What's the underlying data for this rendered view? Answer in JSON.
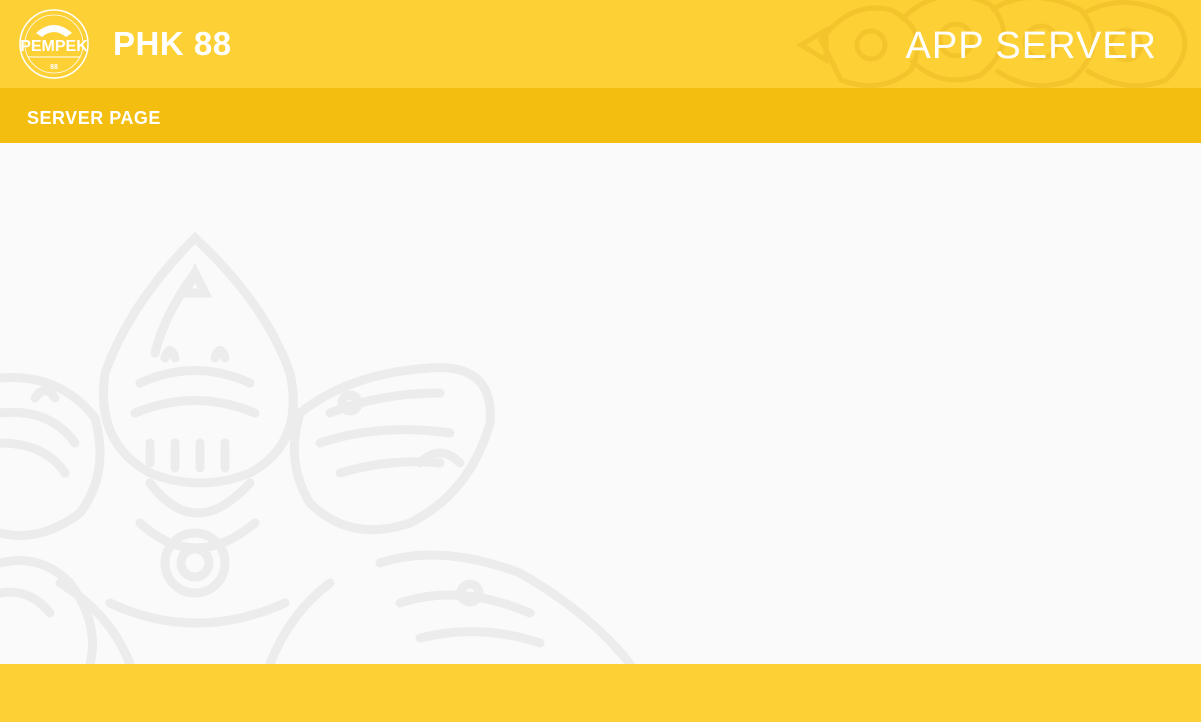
{
  "header": {
    "logo_text": "PEMPEK",
    "logo_number": "88",
    "brand": "PHK 88",
    "app_title": "APP SERVER"
  },
  "subheader": {
    "page_label": "SERVER PAGE"
  },
  "colors": {
    "header_bg": "#fdd035",
    "subheader_bg": "#f3be0f",
    "content_bg": "#fafafa",
    "text": "#ffffff"
  },
  "icons": {
    "logo": "pempek-logo-icon",
    "header_ornament": "mandala-ornament-icon",
    "background_ornament": "mandala-background-icon"
  }
}
